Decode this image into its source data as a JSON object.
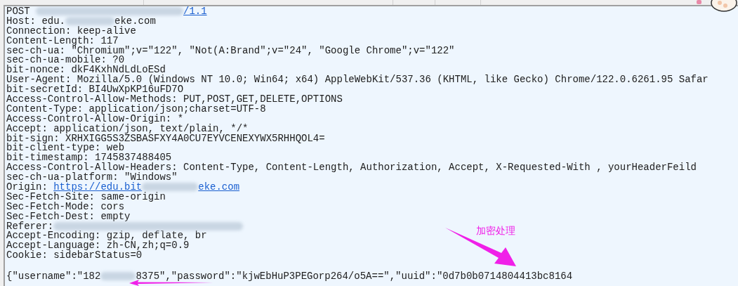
{
  "request_lines": [
    [
      {
        "kind": "text",
        "text": "POST "
      },
      {
        "kind": "redacted"
      },
      {
        "kind": "link",
        "text": "/1.1"
      }
    ],
    [
      {
        "kind": "text",
        "text": "Host: edu."
      },
      {
        "kind": "redacted"
      },
      {
        "kind": "text",
        "text": "eke.com"
      }
    ],
    [
      {
        "kind": "text",
        "text": "Connection: keep-alive"
      }
    ],
    [
      {
        "kind": "text",
        "text": "Content-Length: 117"
      }
    ],
    [
      {
        "kind": "text",
        "text": "sec-ch-ua: \"Chromium\";v=\"122\", \"Not(A:Brand\";v=\"24\", \"Google Chrome\";v=\"122\""
      }
    ],
    [
      {
        "kind": "text",
        "text": "sec-ch-ua-mobile: ?0"
      }
    ],
    [
      {
        "kind": "text",
        "text": "bit-nonce: dkF4KxhNdLdLoESd"
      }
    ],
    [
      {
        "kind": "text",
        "text": "User-Agent: Mozilla/5.0 (Windows NT 10.0; Win64; x64) AppleWebKit/537.36 (KHTML, like Gecko) Chrome/122.0.6261.95 Safar"
      }
    ],
    [
      {
        "kind": "text",
        "text": "bit-secretId: BI4UwXpKP16uFD7O"
      }
    ],
    [
      {
        "kind": "text",
        "text": "Access-Control-Allow-Methods: PUT,POST,GET,DELETE,OPTIONS"
      }
    ],
    [
      {
        "kind": "text",
        "text": "Content-Type: application/json;charset=UTF-8"
      }
    ],
    [
      {
        "kind": "text",
        "text": "Access-Control-Allow-Origin: *"
      }
    ],
    [
      {
        "kind": "text",
        "text": "Accept: application/json, text/plain, */*"
      }
    ],
    [
      {
        "kind": "text",
        "text": "bit-sign: XRHXIGG5S3ZSBASFXY4A0CU7EYVCENEXYWX5RHHQOL4="
      }
    ],
    [
      {
        "kind": "text",
        "text": "bit-client-type: web"
      }
    ],
    [
      {
        "kind": "text",
        "text": "bit-timestamp: 1745837488405"
      }
    ],
    [
      {
        "kind": "text",
        "text": "Access-Control-Allow-Headers: Content-Type, Content-Length, Authorization, Accept, X-Requested-With , yourHeaderFeild"
      }
    ],
    [
      {
        "kind": "text",
        "text": "sec-ch-ua-platform: \"Windows\""
      }
    ],
    [
      {
        "kind": "text",
        "text": "Origin: "
      },
      {
        "kind": "link",
        "text": "https://edu.bit"
      },
      {
        "kind": "redacted"
      },
      {
        "kind": "link",
        "text": "eke.com"
      }
    ],
    [
      {
        "kind": "text",
        "text": "Sec-Fetch-Site: same-origin"
      }
    ],
    [
      {
        "kind": "text",
        "text": "Sec-Fetch-Mode: cors"
      }
    ],
    [
      {
        "kind": "text",
        "text": "Sec-Fetch-Dest: empty"
      }
    ],
    [
      {
        "kind": "text",
        "text": "Referer:"
      },
      {
        "kind": "redacted"
      }
    ],
    [
      {
        "kind": "text",
        "text": "Accept-Encoding: gzip, deflate, br"
      }
    ],
    [
      {
        "kind": "text",
        "text": "Accept-Language: zh-CN,zh;q=0.9"
      }
    ],
    [
      {
        "kind": "text",
        "text": "Cookie: sidebarStatus=0"
      }
    ]
  ],
  "body_line": [
    {
      "kind": "text",
      "text": "{\"username\":\"182"
    },
    {
      "kind": "redacted"
    },
    {
      "kind": "text",
      "text": "8375\",\"password\":\"kjwEbHuP3PEGorp264/o5A==\",\"uuid\":\"0d7b0b0714804413bc8164"
    }
  ],
  "annotation": {
    "text": "加密处理"
  }
}
